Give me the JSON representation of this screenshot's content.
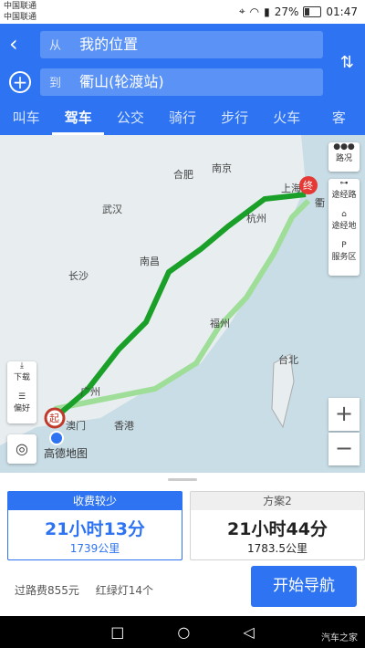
{
  "status": {
    "carrier1": "中国联通",
    "carrier2": "中国联通",
    "battery": "27%",
    "time": "01:47"
  },
  "route": {
    "from_prefix": "从",
    "from": "我的位置",
    "to_prefix": "到",
    "to": "衢山(轮渡站)"
  },
  "tabs": [
    "叫车",
    "驾车",
    "公交",
    "骑行",
    "步行",
    "火车",
    "客"
  ],
  "map": {
    "labels": [
      "南京",
      "合肥",
      "武汉",
      "上海",
      "杭州",
      "长沙",
      "南昌",
      "福州",
      "台北",
      "广州",
      "澳门",
      "香港",
      "衢"
    ],
    "start_marker": "起",
    "end_marker": "终",
    "tools": {
      "traffic": "路况",
      "via_route": "途经路",
      "via_place": "途经地",
      "service": "服务区"
    },
    "left_tools": {
      "download": "下载",
      "prefs": "偏好"
    },
    "zoom_in": "+",
    "zoom_out": "−",
    "logo": "高德地图"
  },
  "plans": [
    {
      "tag": "收费较少",
      "time": "21小时13分",
      "dist": "1739公里"
    },
    {
      "tag": "方案2",
      "time": "21小时44分",
      "dist": "1783.5公里"
    }
  ],
  "fee": "过路费855元",
  "lights": "红绿灯14个",
  "start_nav": "开始导航",
  "watermark": "汽车之家",
  "colors": {
    "brand": "#2e73f2",
    "route_main": "#1aa029",
    "route_alt": "#9fde98"
  }
}
